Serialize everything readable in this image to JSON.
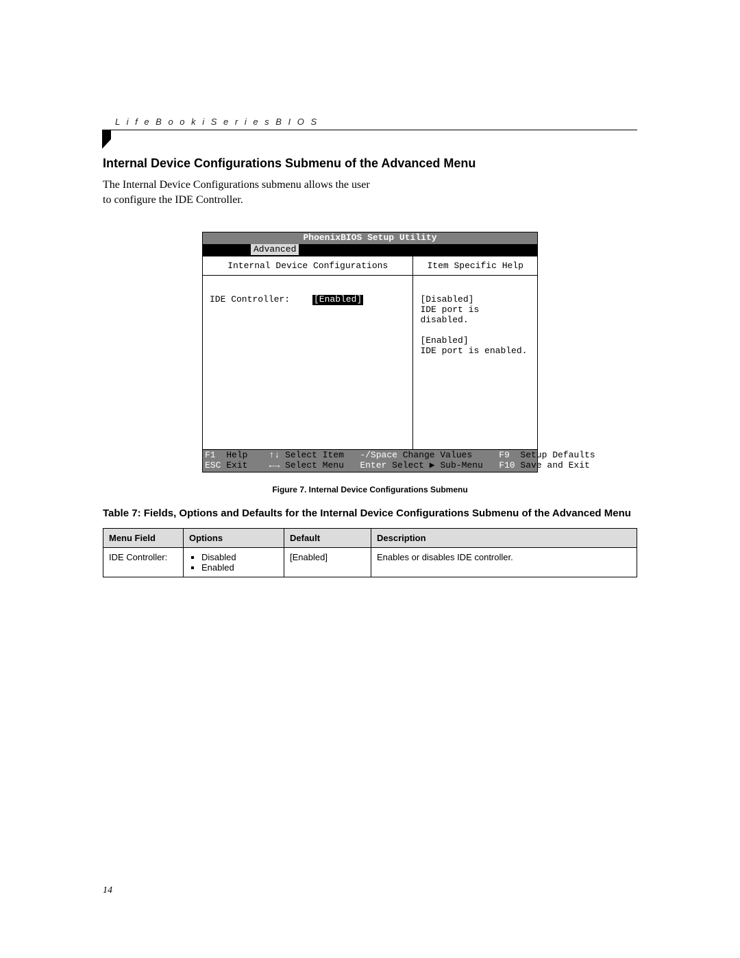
{
  "header": "L i f e B o o k   i   S e r i e s   B I O S",
  "section_title": "Internal Device Configurations Submenu of the Advanced Menu",
  "intro": "The Internal Device Configurations submenu allows the user to configure the IDE Controller.",
  "bios": {
    "title": "PhoenixBIOS Setup Utility",
    "tab": "Advanced",
    "left_title": "Internal Device Configurations",
    "right_title": "Item Specific Help",
    "field_label": "IDE Controller:",
    "field_value": "[Enabled]",
    "help": {
      "l1": "[Disabled]",
      "l2": "IDE port is disabled.",
      "l3": "[Enabled]",
      "l4": "IDE port is enabled."
    },
    "footer": {
      "f1": "F1",
      "f1t": "Help",
      "a1": "↑↓",
      "a1t": "Select Item",
      "a2": "-/Space",
      "a2t": "Change Values",
      "f9": "F9",
      "f9t": "Setup Defaults",
      "esc": "ESC",
      "esct": "Exit",
      "a3": "←→",
      "a3t": "Select Menu",
      "a4": "Enter",
      "a4t": "Select ▶ Sub-Menu",
      "f10": "F10",
      "f10t": "Save and Exit"
    }
  },
  "figure_caption": "Figure 7. Internal Device Configurations Submenu",
  "table_caption": "Table 7: Fields, Options and Defaults for the Internal Device Configurations Submenu of the Advanced Menu",
  "table": {
    "h1": "Menu Field",
    "h2": "Options",
    "h3": "Default",
    "h4": "Description",
    "r1": {
      "field": "IDE Controller:",
      "opt1": "Disabled",
      "opt2": "Enabled",
      "def": "[Enabled]",
      "desc": "Enables or disables IDE controller."
    }
  },
  "page_number": "14"
}
